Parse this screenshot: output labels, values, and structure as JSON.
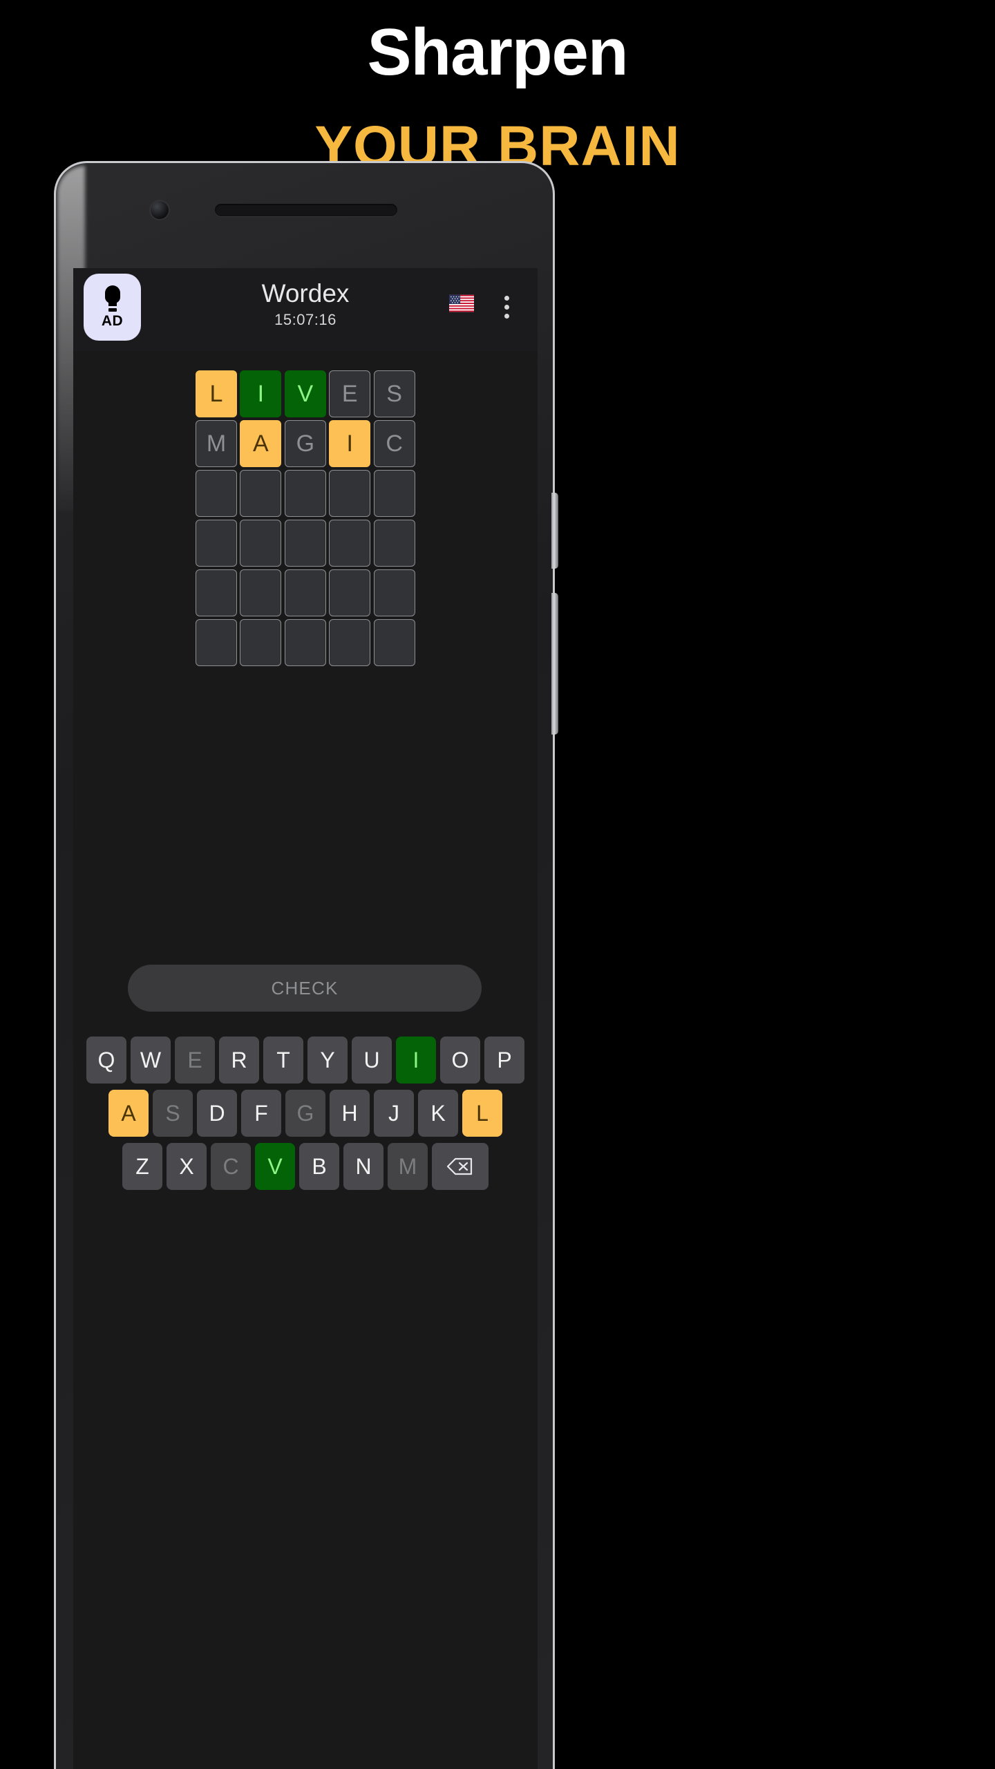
{
  "promo": {
    "title": "Sharpen",
    "subtitle": "YOUR BRAIN",
    "title_color": "#FFFFFF",
    "subtitle_color": "#F6B83F",
    "background_color": "#000000"
  },
  "app": {
    "name": "Wordex",
    "timer": "15:07:16",
    "ad_button": {
      "label": "AD",
      "icon": "lightbulb-icon",
      "background": "#E3E2FB"
    },
    "language_flag": "us-flag-icon",
    "overflow_menu": "kebab-menu-icon",
    "screen_background": "#191919",
    "appbar_background": "#1B1B1D"
  },
  "colors": {
    "present": "#FDC055",
    "present_text": "#4A3406",
    "correct": "#046307",
    "correct_text": "#8CF585",
    "absent": "#323336",
    "absent_text": "#8E9094",
    "key_default": "#4A4A4E",
    "key_text": "#F2F2F2",
    "key_dim_text": "#7C7D81"
  },
  "board": {
    "rows": 6,
    "cols": 5,
    "guesses": [
      [
        {
          "letter": "L",
          "state": "present"
        },
        {
          "letter": "I",
          "state": "correct"
        },
        {
          "letter": "V",
          "state": "correct"
        },
        {
          "letter": "E",
          "state": "absent"
        },
        {
          "letter": "S",
          "state": "absent"
        }
      ],
      [
        {
          "letter": "M",
          "state": "absent"
        },
        {
          "letter": "A",
          "state": "present"
        },
        {
          "letter": "G",
          "state": "absent"
        },
        {
          "letter": "I",
          "state": "present"
        },
        {
          "letter": "C",
          "state": "absent"
        }
      ],
      [
        {
          "letter": "",
          "state": "empty"
        },
        {
          "letter": "",
          "state": "empty"
        },
        {
          "letter": "",
          "state": "empty"
        },
        {
          "letter": "",
          "state": "empty"
        },
        {
          "letter": "",
          "state": "empty"
        }
      ],
      [
        {
          "letter": "",
          "state": "empty"
        },
        {
          "letter": "",
          "state": "empty"
        },
        {
          "letter": "",
          "state": "empty"
        },
        {
          "letter": "",
          "state": "empty"
        },
        {
          "letter": "",
          "state": "empty"
        }
      ],
      [
        {
          "letter": "",
          "state": "empty"
        },
        {
          "letter": "",
          "state": "empty"
        },
        {
          "letter": "",
          "state": "empty"
        },
        {
          "letter": "",
          "state": "empty"
        },
        {
          "letter": "",
          "state": "empty"
        }
      ],
      [
        {
          "letter": "",
          "state": "empty"
        },
        {
          "letter": "",
          "state": "empty"
        },
        {
          "letter": "",
          "state": "empty"
        },
        {
          "letter": "",
          "state": "empty"
        },
        {
          "letter": "",
          "state": "empty"
        }
      ]
    ]
  },
  "check_button": {
    "label": "CHECK"
  },
  "keyboard": {
    "rows": [
      [
        {
          "key": "Q",
          "state": "default"
        },
        {
          "key": "W",
          "state": "default"
        },
        {
          "key": "E",
          "state": "dim"
        },
        {
          "key": "R",
          "state": "default"
        },
        {
          "key": "T",
          "state": "default"
        },
        {
          "key": "Y",
          "state": "default"
        },
        {
          "key": "U",
          "state": "default"
        },
        {
          "key": "I",
          "state": "correct"
        },
        {
          "key": "O",
          "state": "default"
        },
        {
          "key": "P",
          "state": "default"
        }
      ],
      [
        {
          "key": "A",
          "state": "present"
        },
        {
          "key": "S",
          "state": "dim"
        },
        {
          "key": "D",
          "state": "default"
        },
        {
          "key": "F",
          "state": "default"
        },
        {
          "key": "G",
          "state": "dim"
        },
        {
          "key": "H",
          "state": "default"
        },
        {
          "key": "J",
          "state": "default"
        },
        {
          "key": "K",
          "state": "default"
        },
        {
          "key": "L",
          "state": "present"
        }
      ],
      [
        {
          "key": "Z",
          "state": "default"
        },
        {
          "key": "X",
          "state": "default"
        },
        {
          "key": "C",
          "state": "dim"
        },
        {
          "key": "V",
          "state": "correct"
        },
        {
          "key": "B",
          "state": "default"
        },
        {
          "key": "N",
          "state": "default"
        },
        {
          "key": "M",
          "state": "dim"
        },
        {
          "key": "backspace-icon",
          "state": "default",
          "icon": true
        }
      ]
    ]
  }
}
